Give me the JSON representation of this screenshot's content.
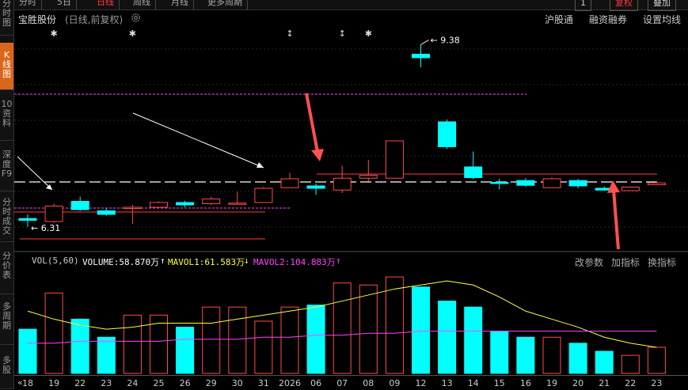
{
  "sidebar": {
    "items": [
      {
        "label": "分时图"
      },
      {
        "label": "K线图"
      },
      {
        "label": "10资料"
      },
      {
        "label": "深度F9"
      },
      {
        "label": "分时成交"
      },
      {
        "label": "分价表"
      },
      {
        "label": "多周期"
      },
      {
        "label": "多股"
      }
    ]
  },
  "topbar": {
    "tabs": [
      "分时",
      "5日",
      "日线",
      "周线",
      "月线",
      "更多周期"
    ],
    "right_buttons": [
      "复权",
      "叠加"
    ],
    "extra": "1"
  },
  "header": {
    "stock_name": "宝胜股份",
    "adjust": "(日线,前复权)",
    "links": [
      "沪股通",
      "融资融券",
      "设置均线"
    ]
  },
  "indicator": {
    "name": "VOL(5,60)",
    "volume": "VOLUME:58.870万",
    "mavol1": "MAVOL1:61.583万",
    "mavol2": "MAVOL2:104.883万",
    "buttons": [
      "改参数",
      "加指标",
      "换指标"
    ]
  },
  "annotations": {
    "high_label": "9.38",
    "low_label": "6.31"
  },
  "xaxis": {
    "labels": [
      "18",
      "19",
      "22",
      "23",
      "24",
      "25",
      "26",
      "29",
      "30",
      "31",
      "2026",
      "06",
      "07",
      "08",
      "09",
      "12",
      "13",
      "14",
      "15",
      "16",
      "19",
      "20",
      "21",
      "22",
      "23"
    ]
  },
  "colors": {
    "up": "#ff4a4a",
    "down": "#00ffff",
    "mavol1": "#ffff44",
    "mavol2": "#ff44ff",
    "accent": "#d9661a"
  },
  "chart_data": {
    "type": "candlestick",
    "candles": [
      {
        "o": 6.45,
        "h": 6.52,
        "l": 6.31,
        "c": 6.42
      },
      {
        "o": 6.4,
        "h": 6.7,
        "l": 6.38,
        "c": 6.66
      },
      {
        "o": 6.74,
        "h": 6.82,
        "l": 6.58,
        "c": 6.6
      },
      {
        "o": 6.58,
        "h": 6.62,
        "l": 6.5,
        "c": 6.52
      },
      {
        "o": 6.62,
        "h": 6.68,
        "l": 6.36,
        "c": 6.64
      },
      {
        "o": 6.64,
        "h": 6.74,
        "l": 6.62,
        "c": 6.72
      },
      {
        "o": 6.72,
        "h": 6.75,
        "l": 6.64,
        "c": 6.68
      },
      {
        "o": 6.7,
        "h": 6.82,
        "l": 6.68,
        "c": 6.78
      },
      {
        "o": 6.7,
        "h": 6.9,
        "l": 6.68,
        "c": 6.71
      },
      {
        "o": 6.72,
        "h": 6.98,
        "l": 6.72,
        "c": 6.96
      },
      {
        "o": 6.97,
        "h": 7.22,
        "l": 6.97,
        "c": 7.12
      },
      {
        "o": 7.0,
        "h": 7.04,
        "l": 6.85,
        "c": 6.96
      },
      {
        "o": 6.93,
        "h": 7.34,
        "l": 6.88,
        "c": 7.13
      },
      {
        "o": 7.13,
        "h": 7.44,
        "l": 7.08,
        "c": 7.18
      },
      {
        "o": 7.13,
        "h": 7.76,
        "l": 7.13,
        "c": 7.76
      },
      {
        "o": 9.22,
        "h": 9.38,
        "l": 9.0,
        "c": 9.16
      },
      {
        "o": 8.08,
        "h": 8.12,
        "l": 7.62,
        "c": 7.66
      },
      {
        "o": 7.32,
        "h": 7.58,
        "l": 7.11,
        "c": 7.14
      },
      {
        "o": 7.06,
        "h": 7.12,
        "l": 6.94,
        "c": 7.04
      },
      {
        "o": 7.09,
        "h": 7.13,
        "l": 6.99,
        "c": 7.01
      },
      {
        "o": 6.97,
        "h": 7.15,
        "l": 6.97,
        "c": 7.12
      },
      {
        "o": 7.09,
        "h": 7.12,
        "l": 6.96,
        "c": 7.0
      },
      {
        "o": 6.96,
        "h": 6.99,
        "l": 6.92,
        "c": 6.93
      },
      {
        "o": 6.92,
        "h": 6.99,
        "l": 6.92,
        "c": 6.98
      },
      {
        "o": 7.02,
        "h": 7.08,
        "l": 7.01,
        "c": 7.05
      }
    ],
    "volume": [
      22,
      40,
      27,
      18,
      29,
      29,
      23,
      33,
      33,
      26,
      33,
      34,
      45,
      44,
      48,
      43,
      36,
      33,
      21,
      18,
      18,
      15,
      11,
      9,
      13
    ],
    "mavol1": [
      31,
      27,
      24,
      22,
      23,
      25,
      25,
      25,
      27,
      29,
      31,
      33,
      36,
      39,
      42,
      44,
      46,
      44,
      38,
      31,
      27,
      23,
      18,
      15,
      13
    ],
    "mavol2": [
      15,
      15,
      16,
      16,
      16,
      16,
      17,
      17,
      17,
      18,
      18,
      19,
      19,
      20,
      20,
      21,
      21,
      21,
      21,
      21,
      21,
      21,
      21,
      21,
      21
    ],
    "ylim": [
      6.0,
      9.6
    ],
    "vol_max": 50
  }
}
